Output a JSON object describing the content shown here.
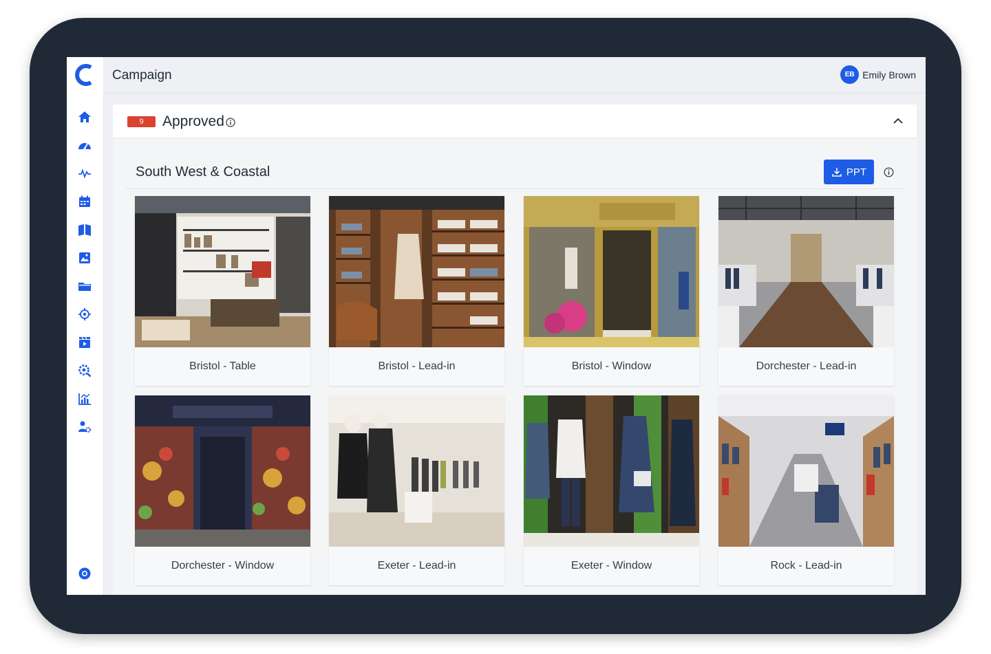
{
  "app": {
    "page_title": "Campaign",
    "user": {
      "initials": "EB",
      "name": "Emily Brown"
    }
  },
  "colors": {
    "accent": "#1e5ce6",
    "badge": "#d9432f",
    "frame": "#1f2a36"
  },
  "sidebar": {
    "items": [
      {
        "icon": "home-icon"
      },
      {
        "icon": "dashboard-gauge-icon"
      },
      {
        "icon": "activity-pulse-icon"
      },
      {
        "icon": "calendar-icon"
      },
      {
        "icon": "book-icon"
      },
      {
        "icon": "image-gallery-icon"
      },
      {
        "icon": "folder-icon"
      },
      {
        "icon": "target-location-icon"
      },
      {
        "icon": "video-clapper-icon"
      },
      {
        "icon": "search-settings-icon"
      },
      {
        "icon": "analytics-chart-icon"
      },
      {
        "icon": "user-settings-icon"
      }
    ],
    "footer_icon": "help-lifebuoy-icon"
  },
  "section": {
    "count": "9",
    "status": "Approved"
  },
  "group": {
    "title": "South West & Coastal",
    "ppt_label": "PPT"
  },
  "cards": [
    {
      "caption": "Bristol - Table"
    },
    {
      "caption": "Bristol - Lead-in"
    },
    {
      "caption": "Bristol - Window"
    },
    {
      "caption": "Dorchester - Lead-in"
    },
    {
      "caption": "Dorchester - Window"
    },
    {
      "caption": "Exeter - Lead-in"
    },
    {
      "caption": "Exeter - Window"
    },
    {
      "caption": "Rock - Lead-in"
    }
  ]
}
